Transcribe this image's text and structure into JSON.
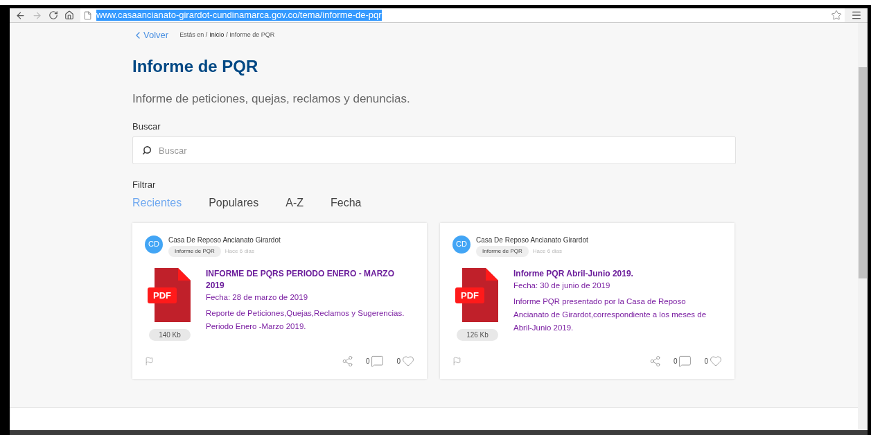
{
  "browser": {
    "url": "www.casaancianato-girardot-cundinamarca.gov.co/tema/informe-de-pqr"
  },
  "breadcrumb": {
    "back": "Volver",
    "prefix": "Estás en /",
    "items": [
      "Inicio",
      "/ Informe de PQR"
    ]
  },
  "title": "Informe de PQR",
  "subtitle": "Informe de peticiones, quejas, reclamos y denuncias.",
  "search": {
    "label": "Buscar",
    "placeholder": "Buscar"
  },
  "filter": {
    "label": "Filtrar",
    "tabs": [
      {
        "label": "Recientes",
        "selected": true
      },
      {
        "label": "Populares",
        "selected": false
      },
      {
        "label": "A-Z",
        "selected": false
      },
      {
        "label": "Fecha",
        "selected": false
      }
    ]
  },
  "cards": [
    {
      "avatar": "CD",
      "author": "Casa De Reposo Ancianato Girardot",
      "tag": "Informe de PQR",
      "time": "Hace 6 dias",
      "file_type": "PDF",
      "size": "140 Kb",
      "title": "INFORME DE PQRS PERIODO ENERO - MARZO 2019",
      "date": "Fecha: 28 de marzo de 2019",
      "description": "Reporte de Peticiones,Quejas,Reclamos y Sugerencias. Periodo Enero -Marzo 2019.",
      "comments": "0",
      "likes": "0"
    },
    {
      "avatar": "CD",
      "author": "Casa De Reposo Ancianato Girardot",
      "tag": "Informe de PQR",
      "time": "Hace 6 dias",
      "file_type": "PDF",
      "size": "126 Kb",
      "title": "Informe PQR Abril-Junio 2019.",
      "date": "Fecha: 30 de junio de 2019",
      "description": "Informe PQR  presentado por la Casa de Reposo Ancianato de Girardot,correspondiente a los meses de Abril-Junio  2019.",
      "comments": "0",
      "likes": "0"
    }
  ]
}
